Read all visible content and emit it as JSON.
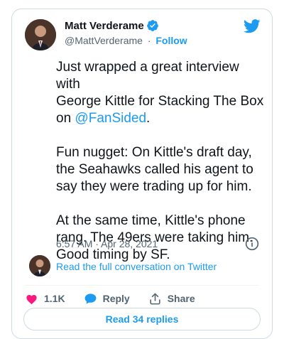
{
  "author": {
    "name": "Matt Verderame",
    "handle": "@MattVerderame",
    "separator": "·",
    "follow_label": "Follow"
  },
  "tweet": {
    "line1_prefix": "Just wrapped a great interview with\nGeorge Kittle for Stacking The Box\non ",
    "mention": "@FanSided",
    "line1_suffix": ".",
    "paragraph2": "Fun nugget: On Kittle's draft day,\nthe Seahawks called his agent to\nsay they were trading up for him.",
    "paragraph3": "At the same time, Kittle's phone\nrang. The 49ers were taking him.\nGood timing by SF."
  },
  "meta": {
    "timestamp": "6:57 AM · Apr 28, 2021"
  },
  "conversation": {
    "label": "Read the full conversation on Twitter"
  },
  "actions": {
    "likes": "1.1K",
    "reply_label": "Reply",
    "share_label": "Share"
  },
  "replies": {
    "label": "Read 34 replies"
  },
  "colors": {
    "accent": "#1d9bf0",
    "like": "#f91880",
    "text": "#0f1419",
    "muted": "#536471"
  },
  "icons": [
    "verified-badge-icon",
    "twitter-bird-icon",
    "info-icon",
    "heart-icon",
    "reply-bubble-icon",
    "share-icon"
  ]
}
